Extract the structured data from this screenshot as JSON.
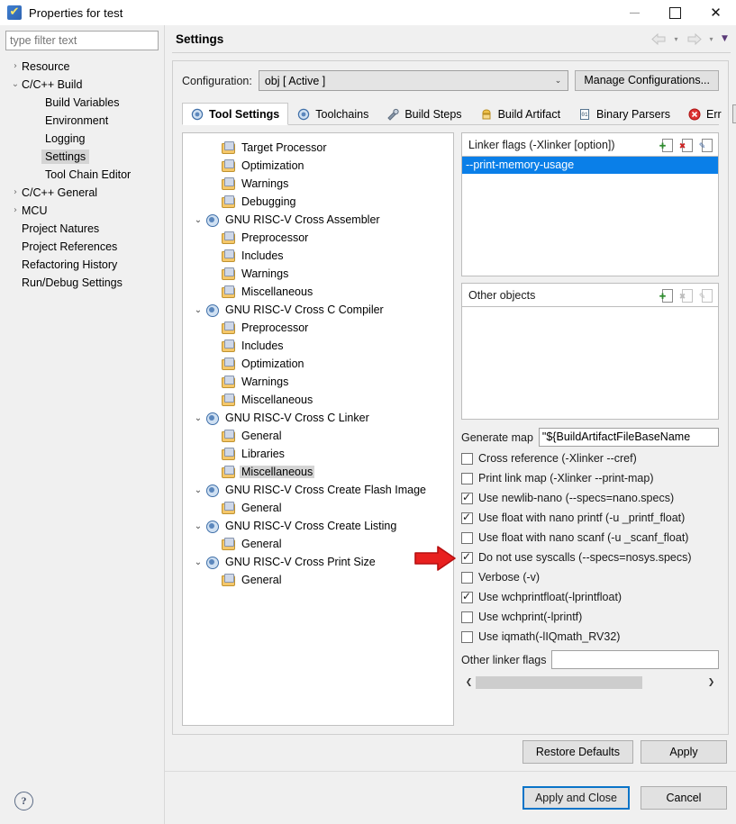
{
  "window": {
    "title": "Properties for test",
    "icon": "eclipse-properties-icon",
    "minimize": "−",
    "maximize": "□",
    "close": "✕"
  },
  "sidebar": {
    "filter_placeholder": "type filter text",
    "filter_value": "",
    "items": [
      {
        "label": "Resource",
        "level": 1,
        "twisty": "collapsed",
        "selected": false
      },
      {
        "label": "C/C++ Build",
        "level": 1,
        "twisty": "expanded",
        "selected": false
      },
      {
        "label": "Build Variables",
        "level": 2,
        "twisty": "none",
        "selected": false
      },
      {
        "label": "Environment",
        "level": 2,
        "twisty": "none",
        "selected": false
      },
      {
        "label": "Logging",
        "level": 2,
        "twisty": "none",
        "selected": false
      },
      {
        "label": "Settings",
        "level": 2,
        "twisty": "none",
        "selected": true
      },
      {
        "label": "Tool Chain Editor",
        "level": 2,
        "twisty": "none",
        "selected": false
      },
      {
        "label": "C/C++ General",
        "level": 1,
        "twisty": "collapsed",
        "selected": false
      },
      {
        "label": "MCU",
        "level": 1,
        "twisty": "collapsed",
        "selected": false
      },
      {
        "label": "Project Natures",
        "level": 1,
        "twisty": "none",
        "selected": false
      },
      {
        "label": "Project References",
        "level": 1,
        "twisty": "none",
        "selected": false
      },
      {
        "label": "Refactoring History",
        "level": 1,
        "twisty": "none",
        "selected": false
      },
      {
        "label": "Run/Debug Settings",
        "level": 1,
        "twisty": "none",
        "selected": false
      }
    ],
    "help_icon": "?"
  },
  "pane": {
    "title": "Settings",
    "nav": {
      "back_icon": "back-arrow-icon",
      "back_caret": "▾",
      "forward_icon": "forward-arrow-icon",
      "forward_caret": "▾",
      "menu_caret": "▼"
    }
  },
  "configuration": {
    "label": "Configuration:",
    "value": "obj  [ Active ]",
    "arrow": "⌄",
    "manage_button": "Manage Configurations..."
  },
  "tabs": {
    "items": [
      {
        "label": "Tool Settings",
        "icon": "tool-settings-icon",
        "active": true
      },
      {
        "label": "Toolchains",
        "icon": "toolchains-icon",
        "active": false
      },
      {
        "label": "Build Steps",
        "icon": "build-steps-icon",
        "active": false
      },
      {
        "label": "Build Artifact",
        "icon": "build-artifact-icon",
        "active": false
      },
      {
        "label": "Binary Parsers",
        "icon": "binary-parsers-icon",
        "active": false
      },
      {
        "label": "Err",
        "icon": "error-parsers-icon",
        "active": false
      }
    ],
    "scroll_left": "◄",
    "scroll_right": "►"
  },
  "tool_tree": {
    "items": [
      {
        "label": "Target Processor",
        "indent": 2,
        "twisty": "none",
        "icon": "folder-icon",
        "selected": false
      },
      {
        "label": "Optimization",
        "indent": 2,
        "twisty": "none",
        "icon": "folder-icon",
        "selected": false
      },
      {
        "label": "Warnings",
        "indent": 2,
        "twisty": "none",
        "icon": "folder-icon",
        "selected": false
      },
      {
        "label": "Debugging",
        "indent": 2,
        "twisty": "none",
        "icon": "folder-icon",
        "selected": false
      },
      {
        "label": "GNU RISC-V Cross Assembler",
        "indent": 1,
        "twisty": "expanded",
        "icon": "tool-icon",
        "selected": false
      },
      {
        "label": "Preprocessor",
        "indent": 2,
        "twisty": "none",
        "icon": "folder-icon",
        "selected": false
      },
      {
        "label": "Includes",
        "indent": 2,
        "twisty": "none",
        "icon": "folder-icon",
        "selected": false
      },
      {
        "label": "Warnings",
        "indent": 2,
        "twisty": "none",
        "icon": "folder-icon",
        "selected": false
      },
      {
        "label": "Miscellaneous",
        "indent": 2,
        "twisty": "none",
        "icon": "folder-icon",
        "selected": false
      },
      {
        "label": "GNU RISC-V Cross C Compiler",
        "indent": 1,
        "twisty": "expanded",
        "icon": "tool-icon",
        "selected": false
      },
      {
        "label": "Preprocessor",
        "indent": 2,
        "twisty": "none",
        "icon": "folder-icon",
        "selected": false
      },
      {
        "label": "Includes",
        "indent": 2,
        "twisty": "none",
        "icon": "folder-icon",
        "selected": false
      },
      {
        "label": "Optimization",
        "indent": 2,
        "twisty": "none",
        "icon": "folder-icon",
        "selected": false
      },
      {
        "label": "Warnings",
        "indent": 2,
        "twisty": "none",
        "icon": "folder-icon",
        "selected": false
      },
      {
        "label": "Miscellaneous",
        "indent": 2,
        "twisty": "none",
        "icon": "folder-icon",
        "selected": false
      },
      {
        "label": "GNU RISC-V Cross C Linker",
        "indent": 1,
        "twisty": "expanded",
        "icon": "tool-icon",
        "selected": false
      },
      {
        "label": "General",
        "indent": 2,
        "twisty": "none",
        "icon": "folder-icon",
        "selected": false
      },
      {
        "label": "Libraries",
        "indent": 2,
        "twisty": "none",
        "icon": "folder-icon",
        "selected": false
      },
      {
        "label": "Miscellaneous",
        "indent": 2,
        "twisty": "none",
        "icon": "folder-icon",
        "selected": true
      },
      {
        "label": "GNU RISC-V Cross Create Flash Image",
        "indent": 1,
        "twisty": "expanded",
        "icon": "tool-icon",
        "selected": false
      },
      {
        "label": "General",
        "indent": 2,
        "twisty": "none",
        "icon": "folder-icon",
        "selected": false
      },
      {
        "label": "GNU RISC-V Cross Create Listing",
        "indent": 1,
        "twisty": "expanded",
        "icon": "tool-icon",
        "selected": false
      },
      {
        "label": "General",
        "indent": 2,
        "twisty": "none",
        "icon": "folder-icon",
        "selected": false
      },
      {
        "label": "GNU RISC-V Cross Print Size",
        "indent": 1,
        "twisty": "expanded",
        "icon": "tool-icon",
        "selected": false
      },
      {
        "label": "General",
        "indent": 2,
        "twisty": "none",
        "icon": "folder-icon",
        "selected": false
      }
    ]
  },
  "linker_flags": {
    "title": "Linker flags (-Xlinker [option])",
    "tools": [
      {
        "name": "add-icon",
        "glyph": "✚",
        "enabled": true
      },
      {
        "name": "delete-icon",
        "glyph": "✖",
        "enabled": true
      },
      {
        "name": "edit-icon",
        "glyph": "✎",
        "enabled": true
      }
    ],
    "items": [
      "--print-memory-usage"
    ],
    "selected_index": 0
  },
  "other_objects": {
    "title": "Other objects",
    "tools": [
      {
        "name": "add-icon",
        "glyph": "✚",
        "enabled": true
      },
      {
        "name": "delete-icon",
        "glyph": "✖",
        "enabled": false
      },
      {
        "name": "edit-icon",
        "glyph": "✎",
        "enabled": false
      }
    ],
    "items": []
  },
  "generate_map": {
    "label": "Generate map",
    "value": "\"${BuildArtifactFileBaseName"
  },
  "options": [
    {
      "label": "Cross reference (-Xlinker --cref)",
      "checked": false
    },
    {
      "label": "Print link map (-Xlinker --print-map)",
      "checked": false
    },
    {
      "label": "Use newlib-nano (--specs=nano.specs)",
      "checked": true
    },
    {
      "label": "Use float with nano printf (-u _printf_float)",
      "checked": true
    },
    {
      "label": "Use float with nano scanf (-u _scanf_float)",
      "checked": false
    },
    {
      "label": "Do not use syscalls (--specs=nosys.specs)",
      "checked": true
    },
    {
      "label": "Verbose (-v)",
      "checked": false
    },
    {
      "label": "Use wchprintfloat(-lprintfloat)",
      "checked": true
    },
    {
      "label": "Use wchprint(-lprintf)",
      "checked": false
    },
    {
      "label": "Use iqmath(-lIQmath_RV32)",
      "checked": false
    }
  ],
  "other_linker_flags": {
    "label": "Other linker flags",
    "value": ""
  },
  "scrollbar": {
    "left_arrow": "❮",
    "right_arrow": "❯"
  },
  "buttons": {
    "restore_defaults": "Restore Defaults",
    "apply": "Apply",
    "apply_and_close": "Apply and Close",
    "cancel": "Cancel"
  },
  "annotation": {
    "arrow": "red-right-arrow",
    "color": "#e8201f"
  },
  "colors": {
    "selection_blue": "#0a7fe8",
    "focus_blue": "#0a74c8",
    "dialog_bg": "#f0f0f0",
    "annotation_red": "#e8201f"
  }
}
